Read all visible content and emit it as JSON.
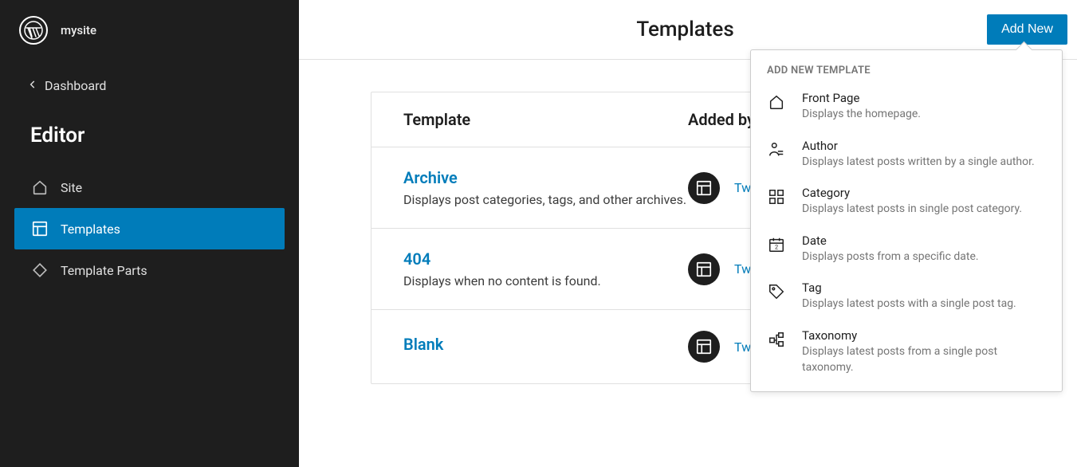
{
  "site": {
    "name": "mysite"
  },
  "sidebar": {
    "back_label": "Dashboard",
    "title": "Editor",
    "items": [
      {
        "label": "Site"
      },
      {
        "label": "Templates"
      },
      {
        "label": "Template Parts"
      }
    ]
  },
  "header": {
    "title": "Templates",
    "add_button": "Add New"
  },
  "table": {
    "col_template": "Template",
    "col_addedby": "Added by",
    "rows": [
      {
        "name": "Archive",
        "desc": "Displays post categories, tags, and other archives.",
        "theme": "Twenty Twenty-Two"
      },
      {
        "name": "404",
        "desc": "Displays when no content is found.",
        "theme": "Twenty Twenty-Two"
      },
      {
        "name": "Blank",
        "desc": "",
        "theme": "Twenty Twenty-Two"
      }
    ]
  },
  "dropdown": {
    "heading": "ADD NEW TEMPLATE",
    "items": [
      {
        "label": "Front Page",
        "desc": "Displays the homepage."
      },
      {
        "label": "Author",
        "desc": "Displays latest posts written by a single author."
      },
      {
        "label": "Category",
        "desc": "Displays latest posts in single post category."
      },
      {
        "label": "Date",
        "desc": "Displays posts from a specific date."
      },
      {
        "label": "Tag",
        "desc": "Displays latest posts with a single post tag."
      },
      {
        "label": "Taxonomy",
        "desc": "Displays latest posts from a single post taxonomy."
      }
    ]
  }
}
